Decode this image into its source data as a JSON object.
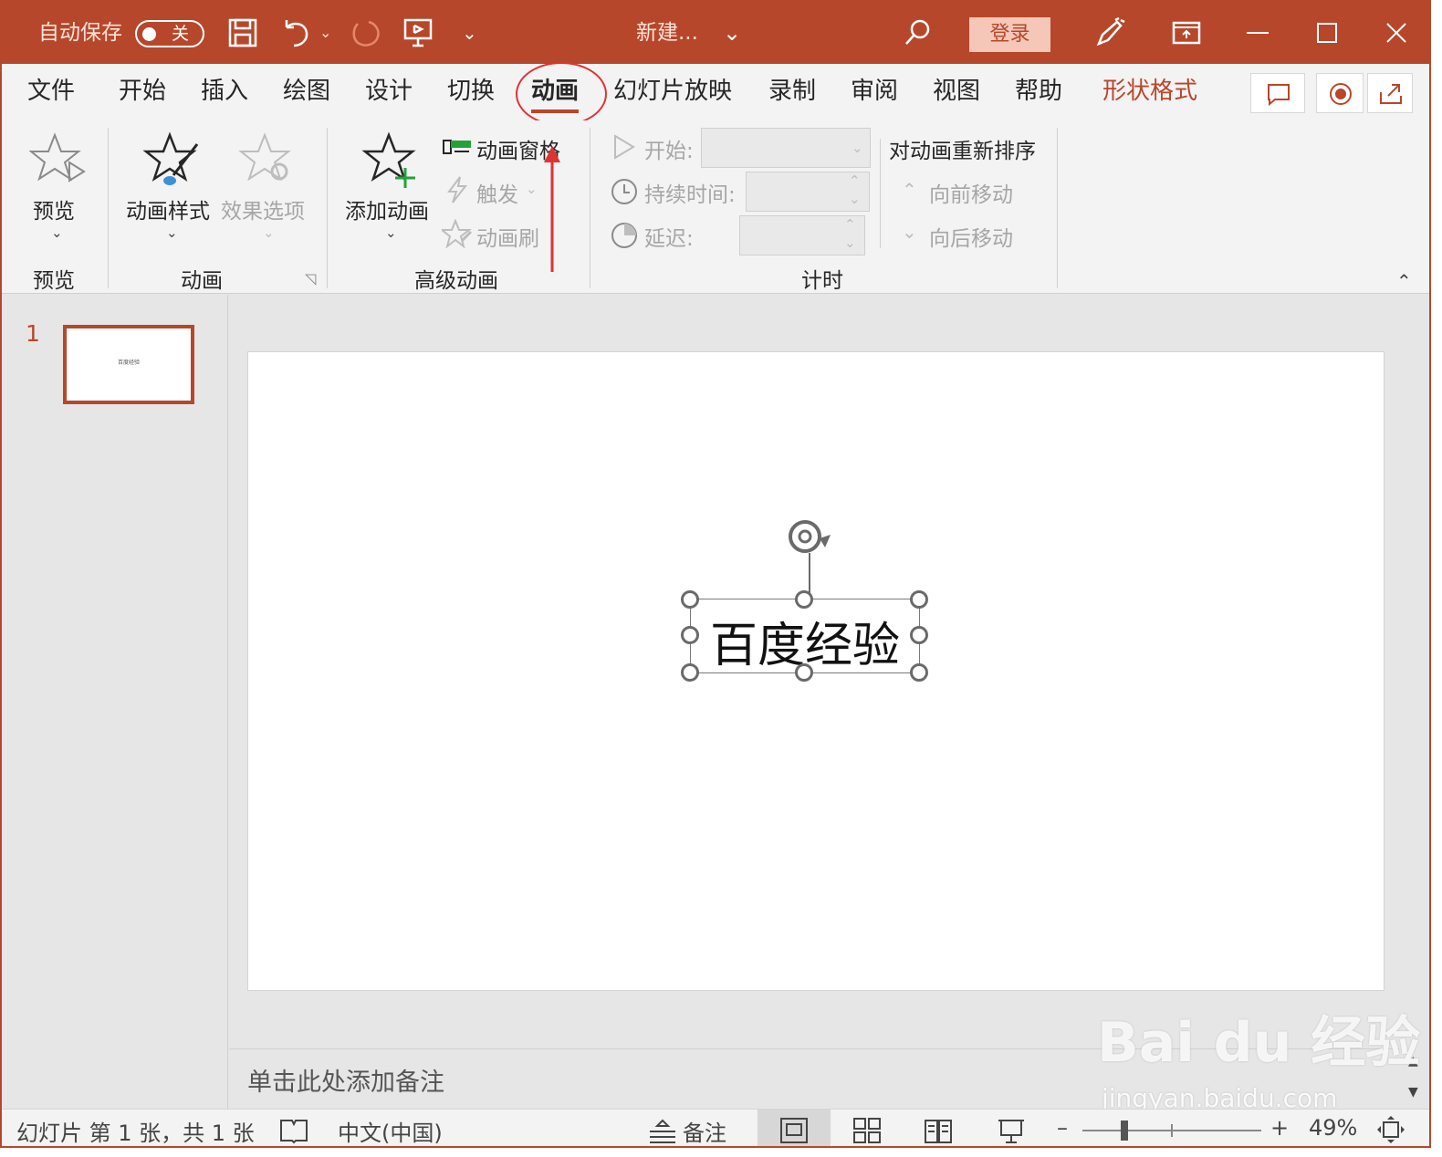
{
  "titlebar": {
    "autosave_label": "自动保存",
    "autosave_state": "关",
    "doc_title": "新建...",
    "login_label": "登录",
    "color": "#b7472a"
  },
  "tabs": [
    {
      "label": "文件"
    },
    {
      "label": "开始"
    },
    {
      "label": "插入"
    },
    {
      "label": "绘图"
    },
    {
      "label": "设计"
    },
    {
      "label": "切换"
    },
    {
      "label": "动画"
    },
    {
      "label": "幻灯片放映"
    },
    {
      "label": "录制"
    },
    {
      "label": "审阅"
    },
    {
      "label": "视图"
    },
    {
      "label": "帮助"
    },
    {
      "label": "形状格式"
    }
  ],
  "ribbon": {
    "preview": {
      "button": "预览",
      "group": "预览"
    },
    "animation": {
      "style_button": "动画样式",
      "effect_button": "效果选项",
      "group": "动画"
    },
    "advanced": {
      "add_button": "添加动画",
      "pane_button": "动画窗格",
      "trigger_button": "触发",
      "painter_button": "动画刷",
      "group": "高级动画"
    },
    "timing": {
      "start_label": "开始:",
      "duration_label": "持续时间:",
      "delay_label": "延迟:",
      "reorder_label": "对动画重新排序",
      "move_earlier": "向前移动",
      "move_later": "向后移动",
      "group": "计时"
    }
  },
  "slides_panel": {
    "slide_number": "1",
    "thumb_text": "百度经验"
  },
  "slide": {
    "text": "百度经验"
  },
  "notes": {
    "placeholder": "单击此处添加备注"
  },
  "statusbar": {
    "slide_info": "幻灯片 第 1 张，共 1 张",
    "language": "中文(中国)",
    "notes_label": "备注",
    "zoom": "49%"
  },
  "watermark": {
    "brand": "Bai du 经验",
    "url": "jingyan.baidu.com"
  }
}
